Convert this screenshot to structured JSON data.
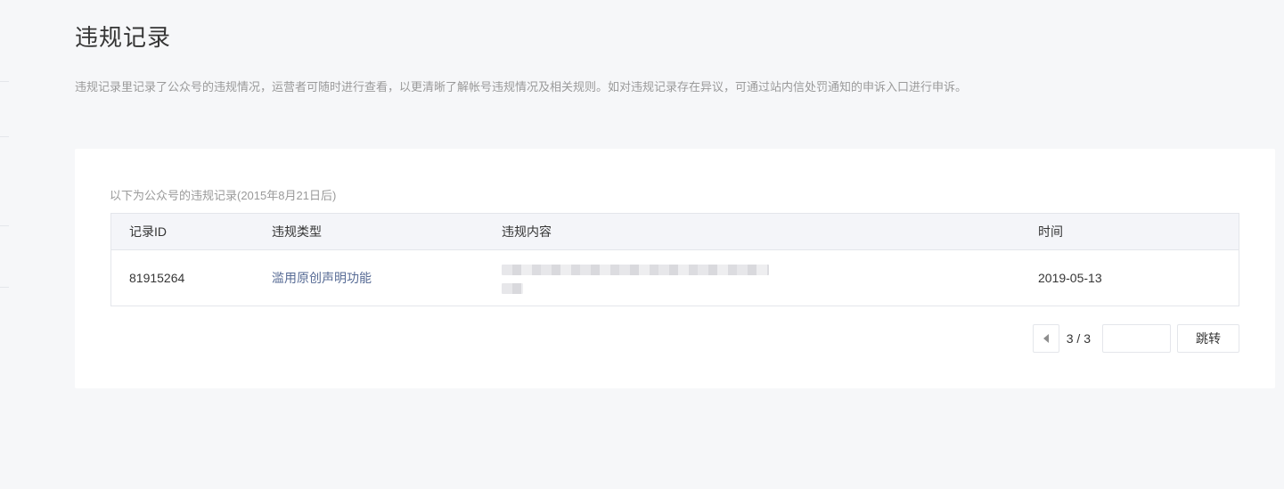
{
  "page": {
    "title": "违规记录",
    "description": "违规记录里记录了公众号的违规情况，运营者可随时进行查看，以更清晰了解帐号违规情况及相关规则。如对违规记录存在异议，可通过站内信处罚通知的申诉入口进行申诉。"
  },
  "records": {
    "caption": "以下为公众号的违规记录(2015年8月21日后)",
    "columns": {
      "id": "记录ID",
      "type": "违规类型",
      "content": "违规内容",
      "time": "时间"
    },
    "rows": [
      {
        "id": "81915264",
        "type": "滥用原创声明功能",
        "time": "2019-05-13"
      }
    ]
  },
  "pager": {
    "page_text": "3 / 3",
    "jump_input_value": "",
    "jump_label": "跳转",
    "prev_icon": "triangle-left-icon"
  },
  "colors": {
    "background": "#f6f7f9",
    "card": "#ffffff",
    "link": "#576b95",
    "muted_text": "#9a9a9a",
    "border": "#e4e6eb"
  }
}
